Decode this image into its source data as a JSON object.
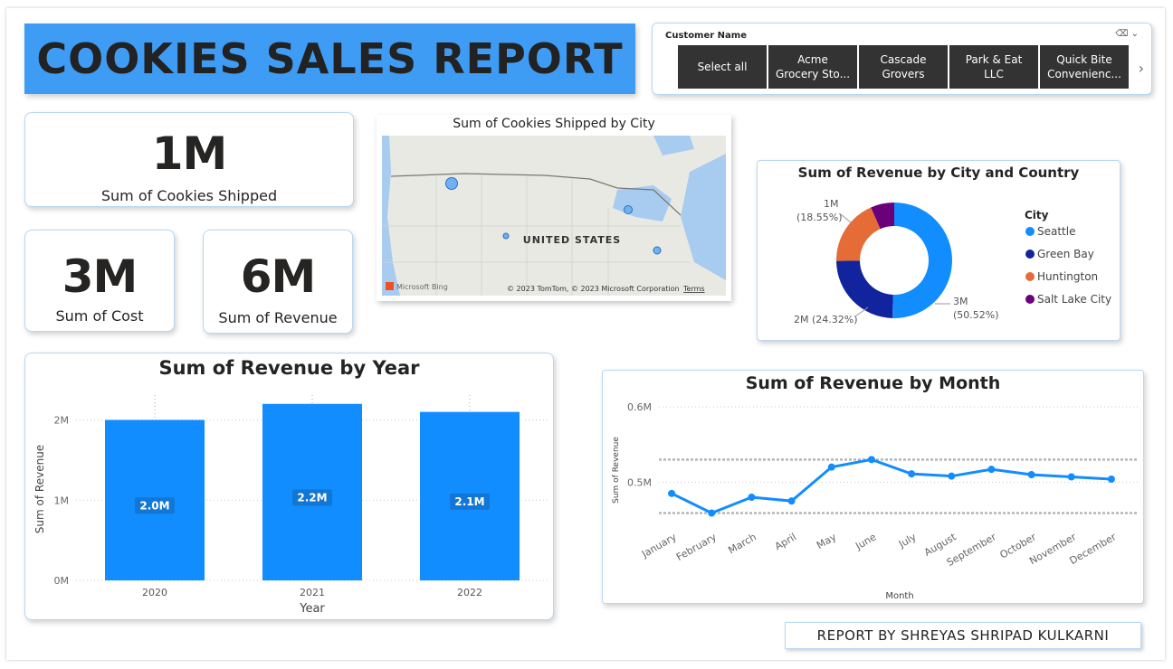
{
  "report": {
    "title": "COOKIES SALES REPORT",
    "credit": "REPORT BY SHREYAS SHRIPAD KULKARNI"
  },
  "slicer": {
    "title": "Customer Name",
    "options": [
      "Select all",
      "Acme\nGrocery Sto...",
      "Cascade\nGrovers",
      "Park & Eat\nLLC",
      "Quick Bite\nConvenienc..."
    ]
  },
  "kpis": {
    "cookies": {
      "value": "1M",
      "label": "Sum of Cookies Shipped"
    },
    "cost": {
      "value": "3M",
      "label": "Sum of Cost"
    },
    "revenue": {
      "value": "6M",
      "label": "Sum of Revenue"
    }
  },
  "map": {
    "title": "Sum of Cookies Shipped by City",
    "country_label": "UNITED STATES",
    "bing_label": "Microsoft Bing",
    "copyright": "© 2023 TomTom, © 2023 Microsoft Corporation",
    "terms": "Terms"
  },
  "colors": {
    "accent": "#3f9cf5",
    "bar": "#118dff",
    "seattle": "#118dff",
    "green_bay": "#12239e",
    "huntington": "#e66c37",
    "salt_lake": "#6b007b"
  },
  "chart_data": [
    {
      "type": "pie",
      "title": "Sum of Revenue by City and Country",
      "legend_title": "City",
      "legend_position": "right",
      "slices": [
        {
          "name": "Seattle",
          "value": 50.52,
          "label": "3M",
          "pct": "(50.52%)"
        },
        {
          "name": "Green Bay",
          "value": 24.32,
          "label": "2M (24.32%)"
        },
        {
          "name": "Huntington",
          "value": 18.55,
          "label": "1M",
          "pct": "(18.55%)"
        },
        {
          "name": "Salt Lake City",
          "value": 6.61
        }
      ]
    },
    {
      "type": "bar",
      "title": "Sum of Revenue by Year",
      "xlabel": "Year",
      "ylabel": "Sum of Revenue",
      "categories": [
        "2020",
        "2021",
        "2022"
      ],
      "values": [
        2.0,
        2.2,
        2.1
      ],
      "data_labels": [
        "2.0M",
        "2.2M",
        "2.1M"
      ],
      "yticks": [
        "0M",
        "1M",
        "2M"
      ],
      "ylim": [
        0,
        2.4
      ]
    },
    {
      "type": "line",
      "title": "Sum of Revenue by Month",
      "xlabel": "Month",
      "ylabel": "Sum of Revenue",
      "categories": [
        "January",
        "February",
        "March",
        "April",
        "May",
        "June",
        "July",
        "August",
        "September",
        "October",
        "November",
        "December"
      ],
      "values": [
        0.485,
        0.459,
        0.48,
        0.475,
        0.52,
        0.53,
        0.511,
        0.508,
        0.517,
        0.51,
        0.507,
        0.504
      ],
      "yticks": [
        "0.5M",
        "0.6M"
      ],
      "ylim": [
        0.45,
        0.6
      ]
    }
  ]
}
